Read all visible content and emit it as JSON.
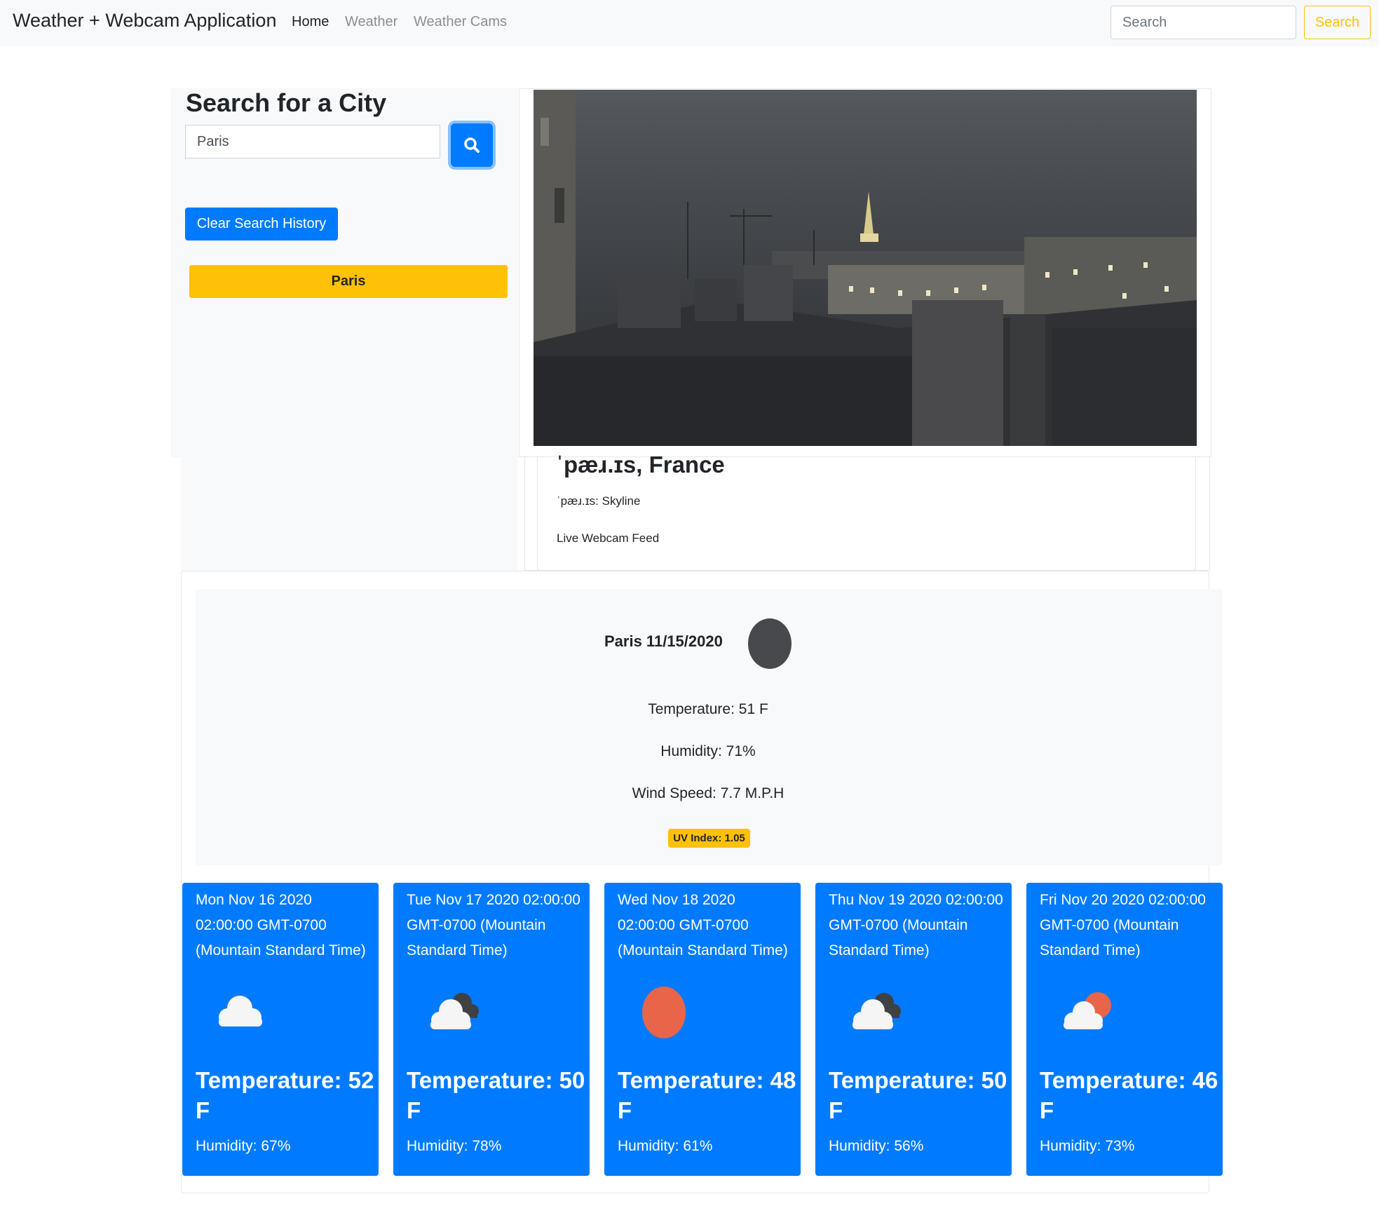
{
  "navbar": {
    "brand": "Weather + Webcam Application",
    "links": [
      "Home",
      "Weather",
      "Weather Cams"
    ],
    "search_placeholder": "Search",
    "search_button": "Search"
  },
  "sidebar": {
    "title": "Search for a City",
    "city_value": "Paris",
    "clear_button": "Clear Search History",
    "history": [
      "Paris"
    ]
  },
  "webcam": {
    "location": "ˈpæɹ.ɪs, France",
    "title": "ˈpæɹ.ɪs: Skyline",
    "feed_label": "Live Webcam Feed"
  },
  "current": {
    "heading": "Paris 11/15/2020",
    "icon": "moon-icon",
    "temperature": "Temperature: 51 F",
    "humidity": "Humidity: 71%",
    "wind": "Wind Speed: 7.7 M.P.H",
    "uv": "UV Index: 1.05"
  },
  "forecast": [
    {
      "date": "Mon Nov 16 2020 02:00:00 GMT-0700 (Mountain Standard Time)",
      "icon": "cloud-icon",
      "temp": "Temperature: 52 F",
      "humidity": "Humidity: 67%"
    },
    {
      "date": "Tue Nov 17 2020 02:00:00 GMT-0700 (Mountain Standard Time)",
      "icon": "cloudy-icon",
      "temp": "Temperature: 50 F",
      "humidity": "Humidity: 78%"
    },
    {
      "date": "Wed Nov 18 2020 02:00:00 GMT-0700 (Mountain Standard Time)",
      "icon": "sun-icon",
      "temp": "Temperature: 48 F",
      "humidity": "Humidity: 61%"
    },
    {
      "date": "Thu Nov 19 2020 02:00:00 GMT-0700 (Mountain Standard Time)",
      "icon": "cloudy-icon",
      "temp": "Temperature: 50 F",
      "humidity": "Humidity: 56%"
    },
    {
      "date": "Fri Nov 20 2020 02:00:00 GMT-0700 (Mountain Standard Time)",
      "icon": "partly-sunny-icon",
      "temp": "Temperature: 46 F",
      "humidity": "Humidity: 73%"
    }
  ],
  "colors": {
    "primary": "#007bff",
    "warning": "#ffc107",
    "light": "#f8f9fa",
    "sun": "#e8654a",
    "moon": "#48494c"
  }
}
